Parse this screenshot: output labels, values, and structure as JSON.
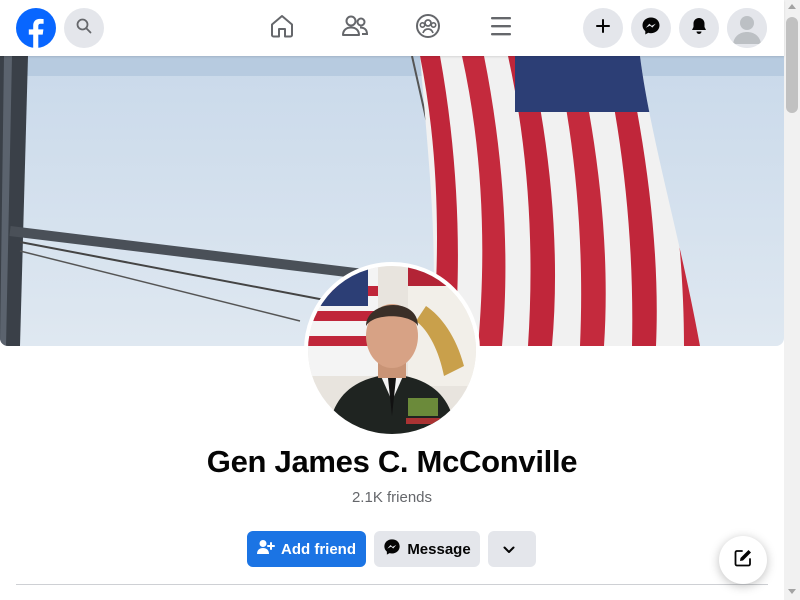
{
  "topbar": {
    "logo_icon": "facebook-logo-icon",
    "search_icon": "search-icon",
    "nav": [
      {
        "name": "nav-home",
        "icon": "home-icon"
      },
      {
        "name": "nav-friends",
        "icon": "friends-icon"
      },
      {
        "name": "nav-groups",
        "icon": "groups-icon"
      },
      {
        "name": "nav-menu",
        "icon": "hamburger-icon"
      }
    ],
    "actions": [
      {
        "name": "create-button",
        "icon": "plus-icon"
      },
      {
        "name": "messenger-button",
        "icon": "messenger-icon"
      },
      {
        "name": "notifications-button",
        "icon": "bell-icon"
      },
      {
        "name": "account-button",
        "icon": "avatar-icon"
      }
    ]
  },
  "profile": {
    "name": "Gen James C. McConville",
    "friends_count": "2.1K friends"
  },
  "actions": {
    "add_friend_label": "Add friend",
    "message_label": "Message",
    "more_icon": "chevron-down-icon"
  },
  "colors": {
    "brand_blue": "#1b74e4",
    "button_gray": "#e4e6eb",
    "text_primary": "#050505",
    "text_secondary": "#65676b"
  }
}
